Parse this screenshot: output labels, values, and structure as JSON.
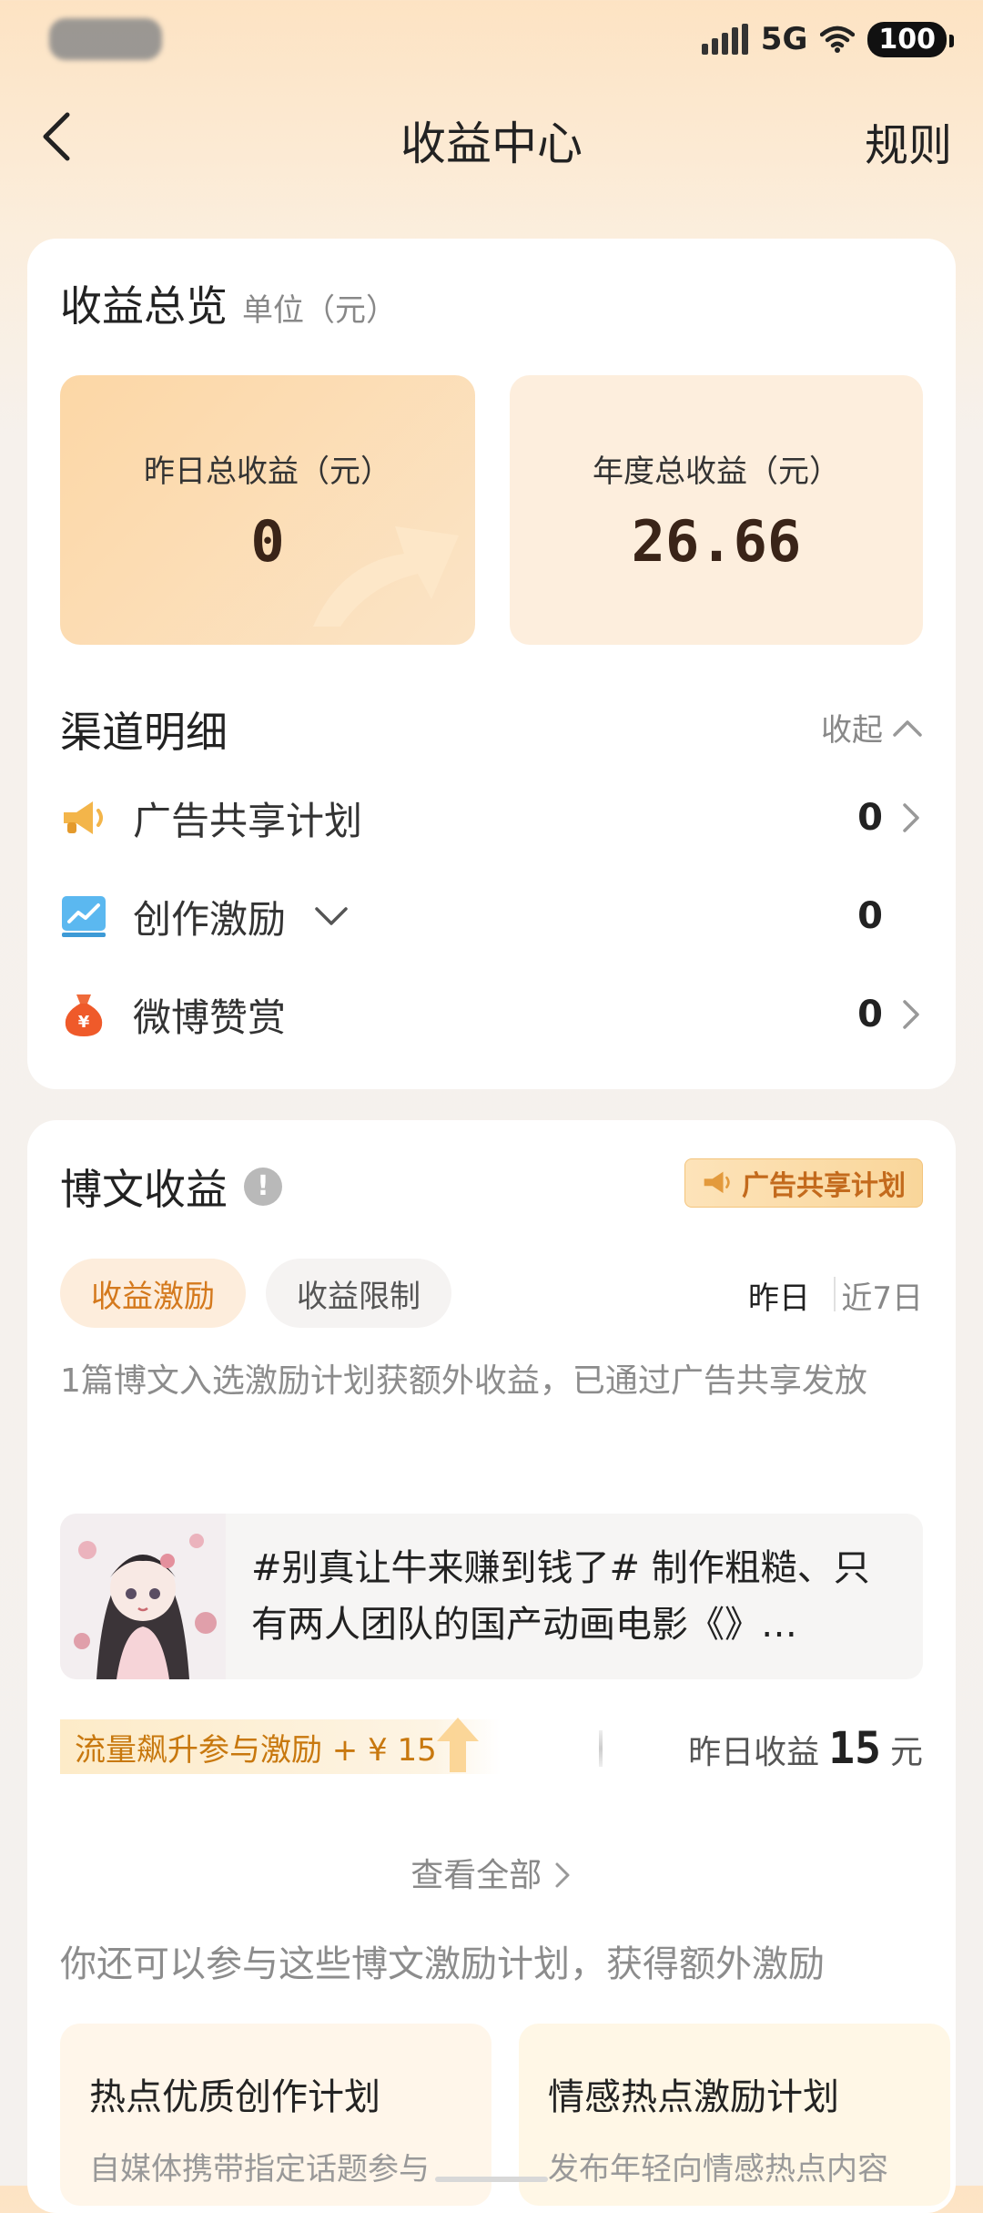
{
  "status_bar": {
    "network": "5G",
    "battery": "100"
  },
  "header": {
    "title": "收益中心",
    "rules_label": "规则"
  },
  "overview": {
    "title": "收益总览",
    "unit": "单位（元）",
    "yesterday": {
      "label": "昨日总收益（元）",
      "value": "0"
    },
    "annual": {
      "label": "年度总收益（元）",
      "value": "26.66"
    }
  },
  "channels": {
    "title": "渠道明细",
    "collapse_label": "收起",
    "items": [
      {
        "label": "广告共享计划",
        "value": "0",
        "icon": "megaphone-icon"
      },
      {
        "label": "创作激励",
        "value": "0",
        "icon": "chart-screen-icon"
      },
      {
        "label": "微博赞赏",
        "value": "0",
        "icon": "money-bag-icon"
      }
    ]
  },
  "post_income": {
    "title": "博文收益",
    "badge": "广告共享计划",
    "tabs": [
      "收益激励",
      "收益限制"
    ],
    "periods": [
      "昨日",
      "近7日"
    ],
    "description": "1篇博文入选激励计划获额外收益，已通过广告共享发放",
    "post": {
      "text": "#别真让牛来赚到钱了# 制作粗糙、只有两人团队的国产动画电影《》…"
    },
    "boost": "流量飙升参与激励 + ¥ 15",
    "yesterday": {
      "label": "昨日收益",
      "value": "15",
      "unit": "元"
    },
    "view_all": "查看全部",
    "more_tip": "你还可以参与这些博文激励计划，获得额外激励",
    "plans": [
      {
        "title": "热点优质创作计划",
        "desc": "自媒体携带指定话题参与"
      },
      {
        "title": "情感热点激励计划",
        "desc": "发布年轻向情感热点内容"
      }
    ]
  },
  "colors": {
    "accent": "#d4791d",
    "card": "#ffffff",
    "summary_left": "#fcd7a6",
    "summary_right": "#fdeedd"
  }
}
